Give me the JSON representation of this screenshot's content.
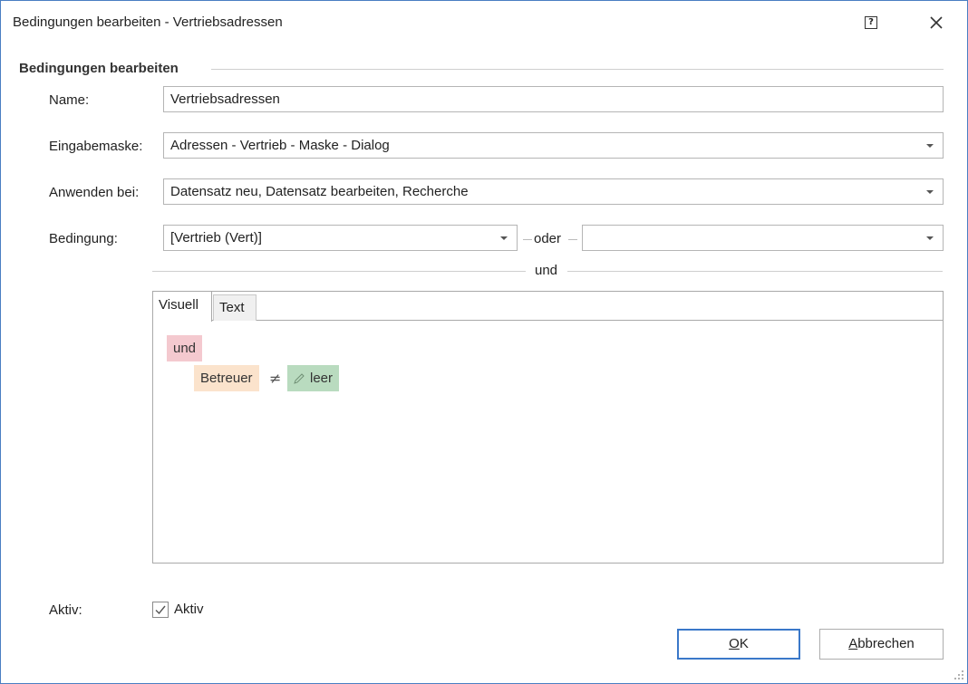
{
  "window": {
    "title": "Bedingungen bearbeiten - Vertriebsadressen"
  },
  "group": {
    "header": "Bedingungen bearbeiten"
  },
  "form": {
    "name_label": "Name:",
    "name_value": "Vertriebsadressen",
    "eingabemaske_label": "Eingabemaske:",
    "eingabemaske_value": "Adressen - Vertrieb - Maske - Dialog",
    "anwenden_label": "Anwenden bei:",
    "anwenden_value": "Datensatz neu, Datensatz bearbeiten, Recherche",
    "bedingung_label": "Bedingung:",
    "bedingung_value": "[Vertrieb (Vert)]",
    "oder_label": "oder",
    "oder_value": "",
    "und_label": "und"
  },
  "editor": {
    "tabs": [
      {
        "label": "Visuell",
        "active": true
      },
      {
        "label": "Text",
        "active": false
      }
    ],
    "tree": {
      "operator": "und",
      "field": "Betreuer",
      "comparison": "≠",
      "value": "leer"
    }
  },
  "active": {
    "label": "Aktiv:",
    "checkbox_label": "Aktiv",
    "checked": true
  },
  "buttons": {
    "ok_prefix": "",
    "ok_mnemonic": "O",
    "ok_rest": "K",
    "cancel_mnemonic": "A",
    "cancel_rest": "bbrechen"
  },
  "colors": {
    "window_border": "#4a7ec2",
    "ok_border": "#3a78c9",
    "chip_operator": "#f4c9cf",
    "chip_field": "#fbe3cc",
    "chip_value": "#b9dbbf"
  },
  "icons": {
    "help": "help-icon",
    "close": "close-icon",
    "edit": "pencil-icon",
    "check": "check-icon",
    "dropdown": "chevron-down-icon"
  }
}
